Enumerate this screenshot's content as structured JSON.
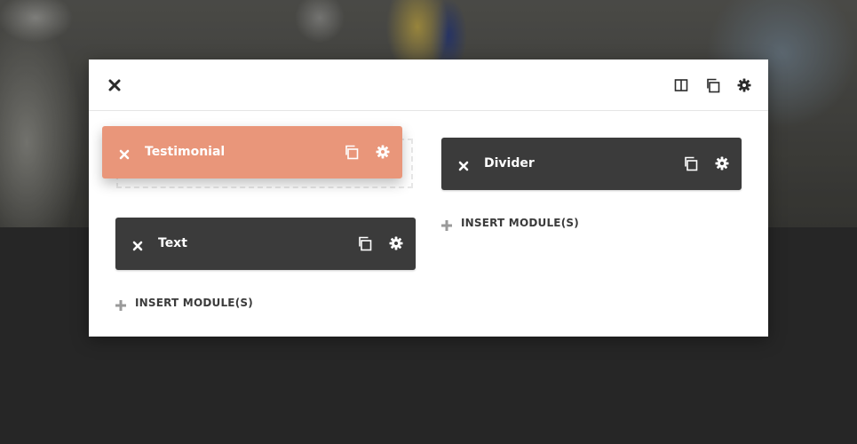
{
  "colors": {
    "module_bg": "#3b3b3b",
    "module_dragging_bg": "#e9967a",
    "modal_bg": "#ffffff",
    "page_bg": "#262626"
  },
  "header": {
    "icons": [
      "close-icon",
      "columns-icon",
      "copy-icon",
      "gear-icon"
    ]
  },
  "columns": [
    {
      "modules": [
        {
          "title": "Testimonial",
          "state": "dragging"
        },
        {
          "title": "Text",
          "state": "normal"
        }
      ],
      "insert_label": "INSERT MODULE(S)"
    },
    {
      "modules": [
        {
          "title": "Divider",
          "state": "normal"
        }
      ],
      "insert_label": "INSERT MODULE(S)"
    }
  ]
}
